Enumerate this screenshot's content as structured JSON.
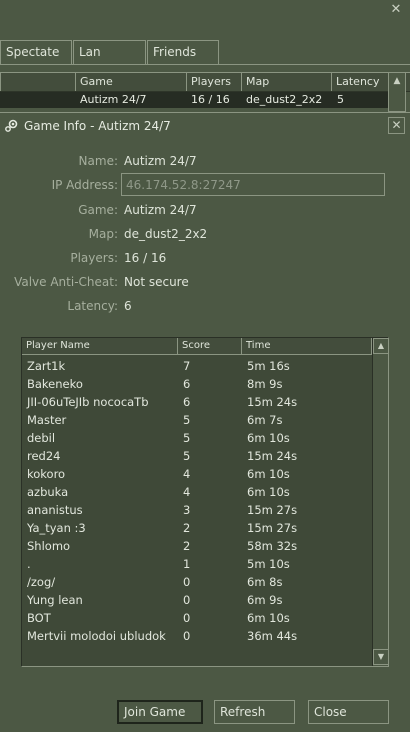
{
  "tabs": [
    "Spectate",
    "Lan",
    "Friends"
  ],
  "columns": {
    "game": "Game",
    "players": "Players",
    "map": "Map",
    "latency": "Latency"
  },
  "server_row": {
    "game": "Autizm 24/7",
    "players": "16 / 16",
    "map": "de_dust2_2x2",
    "latency": "5"
  },
  "dialog": {
    "title": "Game Info - Autizm 24/7",
    "fields": {
      "name_label": "Name:",
      "name": "Autizm 24/7",
      "ip_label": "IP Address:",
      "ip": "46.174.52.8:27247",
      "game_label": "Game:",
      "game": "Autizm 24/7",
      "map_label": "Map:",
      "map": "de_dust2_2x2",
      "players_label": "Players:",
      "players": "16 / 16",
      "vac_label": "Valve Anti-Cheat:",
      "vac": "Not secure",
      "latency_label": "Latency:",
      "latency": "6"
    },
    "player_columns": {
      "name": "Player Name",
      "score": "Score",
      "time": "Time"
    },
    "players": [
      {
        "name": "Zart1k",
        "score": "7",
        "time": "5m 16s"
      },
      {
        "name": "Bakeneko",
        "score": "6",
        "time": "8m 9s"
      },
      {
        "name": "JII-06uTeJIb nococaTb",
        "score": "6",
        "time": "15m 24s"
      },
      {
        "name": "Master",
        "score": "5",
        "time": "6m 7s"
      },
      {
        "name": "debil",
        "score": "5",
        "time": "6m 10s"
      },
      {
        "name": "red24",
        "score": "5",
        "time": "15m 24s"
      },
      {
        "name": "kokoro",
        "score": "4",
        "time": "6m 10s"
      },
      {
        "name": "azbuka",
        "score": "4",
        "time": "6m 10s"
      },
      {
        "name": "ananistus",
        "score": "3",
        "time": "15m 27s"
      },
      {
        "name": "Ya_tyan :3",
        "score": "2",
        "time": "15m 27s"
      },
      {
        "name": "Shlomo",
        "score": "2",
        "time": "58m 32s"
      },
      {
        "name": ".",
        "score": "1",
        "time": "5m 10s"
      },
      {
        "name": "/zog/",
        "score": "0",
        "time": "6m 8s"
      },
      {
        "name": "Yung lean",
        "score": "0",
        "time": "6m 9s"
      },
      {
        "name": "BOT",
        "score": "0",
        "time": "6m 10s"
      },
      {
        "name": "Mertvii molodoi ubludok",
        "score": "0",
        "time": "36m 44s"
      }
    ],
    "buttons": {
      "join": "Join Game",
      "refresh": "Refresh",
      "close": "Close"
    }
  },
  "icons": {
    "close": "close-icon",
    "steam": "steam-icon",
    "scroll_up": "scroll-up-icon",
    "scroll_down": "scroll-down-icon"
  },
  "colors": {
    "background": "#4c5844",
    "border": "#8b9582",
    "selected_row": "#262c23",
    "list_bg": "#3f4938"
  }
}
